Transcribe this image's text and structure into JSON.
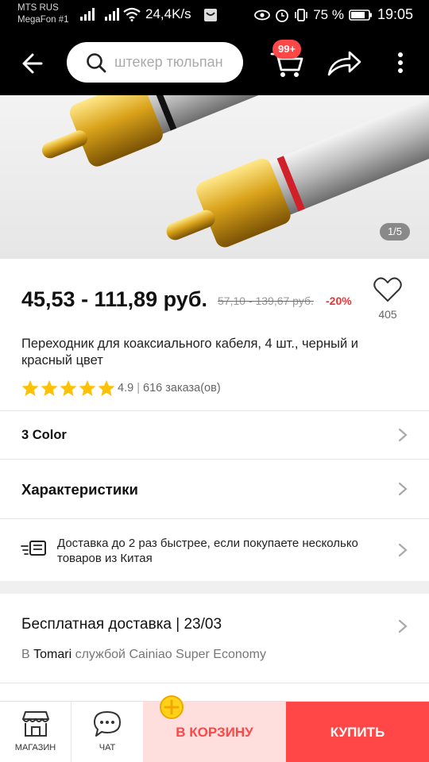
{
  "status_bar": {
    "carrier_1": "MTS RUS",
    "carrier_2": "MegaFon #1",
    "net_speed": "24,4K/s",
    "battery_percent": "75 %",
    "time": "19:05"
  },
  "toolbar": {
    "search_placeholder": "штекер тюльпан",
    "cart_badge": "99+"
  },
  "product": {
    "image_counter": "1/5",
    "price": "45,53 - 111,89 руб.",
    "old_price": "57,10 - 139,67 руб.",
    "discount": "-20%",
    "wishlist_count": "405",
    "title": "Переходник для коаксиального кабеля, 4 шт., черный и красный цвет",
    "rating_value": "4.9",
    "rating_sep": "|",
    "orders": "616 заказа(ов)",
    "rating_stars": 5
  },
  "options": {
    "color_label": "3 Color",
    "specs_label": "Характеристики"
  },
  "delivery": {
    "promo": "Доставка до 2 раз быстрее, если покупаете несколько товаров из Китая",
    "free_shipping": "Бесплатная доставка | 23/03",
    "via_prefix": "В",
    "store": "Tomari",
    "via_suffix": "службой Cainiao Super Economy"
  },
  "bottom_bar": {
    "store_label": "МАГАЗИН",
    "chat_label": "ЧАТ",
    "add_to_cart": "В КОРЗИНУ",
    "buy": "КУПИТЬ"
  },
  "colors": {
    "accent": "#ff4747",
    "cart_bg": "#ffdede",
    "star": "#ffc107"
  }
}
